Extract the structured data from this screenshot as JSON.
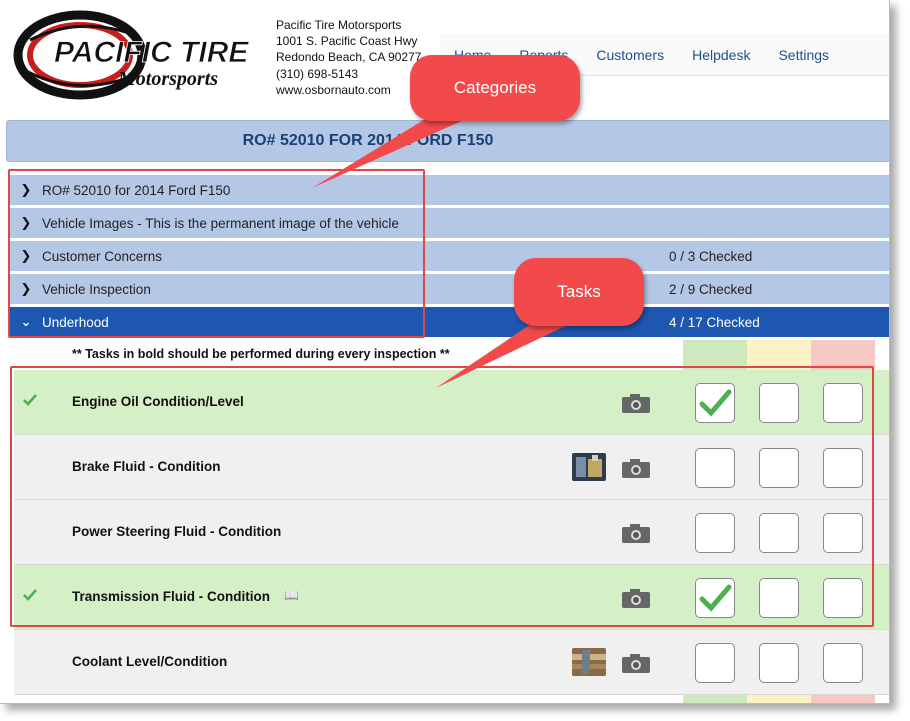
{
  "shop": {
    "name": "Pacific Tire Motorsports",
    "address1": "1001 S. Pacific Coast Hwy",
    "address2": "Redondo Beach, CA 90277",
    "phone": "(310) 698-5143",
    "website": "www.osbornauto.com",
    "logo_line1": "PACIFIC TIRE",
    "logo_line2": "Motorsports"
  },
  "nav": {
    "items": [
      "Home",
      "Reports",
      "Customers",
      "Helpdesk",
      "Settings"
    ]
  },
  "ro_title": "RO# 52010 FOR 2014 FORD F150",
  "categories": [
    {
      "label": "RO# 52010 for 2014 Ford F150",
      "count": "",
      "expanded": false
    },
    {
      "label": "Vehicle Images - This is the permanent image of the vehicle",
      "count": "",
      "expanded": false
    },
    {
      "label": "Customer Concerns",
      "count": "0 / 3 Checked",
      "expanded": false
    },
    {
      "label": "Vehicle Inspection",
      "count": "2 / 9 Checked",
      "expanded": false
    },
    {
      "label": "Underhood",
      "count": "4 / 17 Checked",
      "expanded": true
    }
  ],
  "note": "** Tasks in bold should be performed during every inspection **",
  "tasks": [
    {
      "name": "Engine Oil Condition/Level",
      "status": "ok",
      "has_thumb": false,
      "has_book": false
    },
    {
      "name": "Brake Fluid - Condition",
      "status": "none",
      "has_thumb": true,
      "has_book": false
    },
    {
      "name": "Power Steering Fluid - Condition",
      "status": "none",
      "has_thumb": false,
      "has_book": false
    },
    {
      "name": "Transmission Fluid - Condition",
      "status": "ok",
      "has_thumb": false,
      "has_book": true
    },
    {
      "name": "Coolant Level/Condition",
      "status": "none",
      "has_thumb": true,
      "has_book": false
    }
  ],
  "annotations": {
    "categories_label": "Categories",
    "tasks_label": "Tasks"
  },
  "colors": {
    "category_bg": "#b4c8e6",
    "category_active_bg": "#1d57b1",
    "task_done_bg": "#d5efc7",
    "col_ok": "#cfe8bf",
    "col_warn": "#fbf3c6",
    "col_bad": "#f6c9c5",
    "check_green": "#4caf50",
    "callout_red": "#f24a4a"
  },
  "icons": {
    "category_collapsed": "chevron-right-icon",
    "category_expanded": "chevron-down-icon",
    "task_done": "checkmark-icon",
    "photo": "camera-icon",
    "reference": "book-icon"
  }
}
